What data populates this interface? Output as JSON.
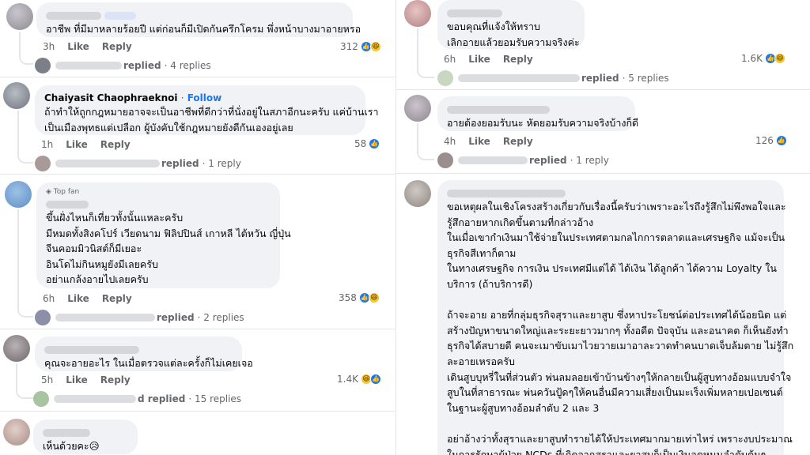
{
  "left_column": {
    "comments": [
      {
        "name": "",
        "lines": [
          "อาชีพ ที่มีมาหลายร้อยปี  แต่ก่อนก็มีเปิดกันครึกโครม  พึ่งหน้าบางมาอายหรอ"
        ],
        "time": "3h",
        "like_label": "Like",
        "reply_label": "Reply",
        "reactions": "312",
        "replies_word": "replied",
        "replies_count": "· 4 replies"
      },
      {
        "name": "Chaiyasit Chaophraeknoi",
        "follow": "Follow",
        "dot": "·",
        "lines": [
          "ถ้าทำให้ถูกกฎหมายอาจจะเป็นอาชีพที่ดีกว่าที่นั่งอยู่ในสภาอีกนะครับ แค่บ้านเรา",
          "เป็นเมืองพุทธแต่เปลือก ผู้บังคับใช้กฎหมายยังดีกันเองอยู่เลย"
        ],
        "time": "1h",
        "like_label": "Like",
        "reply_label": "Reply",
        "reactions": "58",
        "replies_word": "replied",
        "replies_count": "· 1 reply"
      },
      {
        "badge": "Top fan",
        "name": "",
        "lines": [
          "ขึ้นฝั่งไหนก็เที่ยวทั้งนั้นแหละครับ",
          "มีหมดทั้งสิงคโปร์ เวียดนาม ฟิลิปปินส์ เกาหลี ไต้หวัน ญี่ปุ่น",
          "จีนคอมมิวนิสต์ก็มีเยอะ",
          "อินโดไม่กินหมูยังมีเลยครับ",
          "อย่าแกล้งอายไปเลยครับ"
        ],
        "time": "6h",
        "like_label": "Like",
        "reply_label": "Reply",
        "reactions": "358",
        "replies_word": "replied",
        "replies_count": "· 2 replies"
      },
      {
        "name": "",
        "lines": [
          "คุณจะอายอะไร ในเมื่อตรวจแต่ละครั้งก็ไม่เคยเจอ"
        ],
        "time": "5h",
        "like_label": "Like",
        "reply_label": "Reply",
        "reactions": "1.4K",
        "replies_word": "d replied",
        "replies_count": "· 15 replies"
      },
      {
        "name": "",
        "lines": [
          "เห็นด้วยคะ😥"
        ]
      }
    ]
  },
  "right_column": {
    "comments": [
      {
        "name": "",
        "lines": [
          "ขอบคุณที่แจ้งให้ทราบ",
          "เลิกอายแล้วยอมรับความจริงค่ะ"
        ],
        "time": "6h",
        "like_label": "Like",
        "reply_label": "Reply",
        "reactions": "1.6K",
        "replies_word": "replied",
        "replies_count": "· 5 replies"
      },
      {
        "name": "",
        "lines": [
          "อายต้องยอมรับนะ หัดยอมรับความจริงบ้างก็ดี"
        ],
        "time": "4h",
        "like_label": "Like",
        "reply_label": "Reply",
        "reactions": "126",
        "replies_word": "replied",
        "replies_count": "· 1 reply"
      },
      {
        "name": "",
        "lines": [
          "ขอเหตุผลในเชิงโครงสร้างเกี่ยวกับเรื่องนี้ครับว่าเพราะอะไรถึงรู้สึกไม่พึงพอใจและ",
          "รู้สึกอายหากเกิดขึ้นตามที่กล่าวอ้าง",
          "ในเมื่อเขากำเงินมาใช้จ่ายในประเทศตามกลไกการตลาดและเศรษฐกิจ แม้จะเป็น",
          "ธุรกิจสีเทาก็ตาม",
          "ในทางเศรษฐกิจ การเงิน ประเทศมีแต่ได้ ได้เงิน ได้ลูกค้า ได้ความ Loyalty ใน",
          "บริการ (ถ้าบริการดี)",
          "",
          "ถ้าจะอาย อายที่กลุ่มธุรกิจสุราและยาสูบ ซึ่งหาประโยชน์ต่อประเทศได้น้อยนิด แต่",
          "สร้างปัญหาขนาดใหญ่และระยะยาวมากๆ ทั้งอดีต ปัจจุบัน และอนาคต ก็เห็นยังทำ",
          "ธุรกิจได้สบายดี คนจะเมาขับเมาไวยวายเมาอาละวาดทำคนบาดเจ็บล้มตาย ไม่รู้สึก",
          "ละอายเหรอครับ",
          "เดินสูบบุหรี่ในที่ส่วนตัว พ่นลมลอยเข้าบ้านข้างๆให้กลายเป็นผู้สูบทางอ้อมแบบจำใจ",
          "สูบในที่สาธารณะ พ่นควันปู้ดๆให้คนอื่นมีความเสี่ยงเป็นมะเร็งเพิ่มหลายเปอเซนต์",
          "ในฐานะผู้สูบทางอ้อมลำดับ 2 และ 3",
          "",
          "อย่าอ้างว่าทั้งสุราและยาสูบทำรายได้ให้ประเทศมากมายเท่าไหร่ เพราะงบประมาณ",
          "ในการรักษาผู้ป่วย NCDs ที่เกิดจากสุราและยาสูบก็เป็นเงินอุดหนุนลำดับต้นๆ"
        ]
      }
    ]
  },
  "colors": {
    "like_blue": "#1877f2",
    "bubble_gray": "#f0f2f5",
    "meta_gray": "#65676b",
    "haha_yellow": "#f7c52d"
  },
  "icons": {
    "like": "like-reaction-icon",
    "haha": "haha-reaction-icon",
    "top_fan": "top-fan-badge-icon"
  }
}
